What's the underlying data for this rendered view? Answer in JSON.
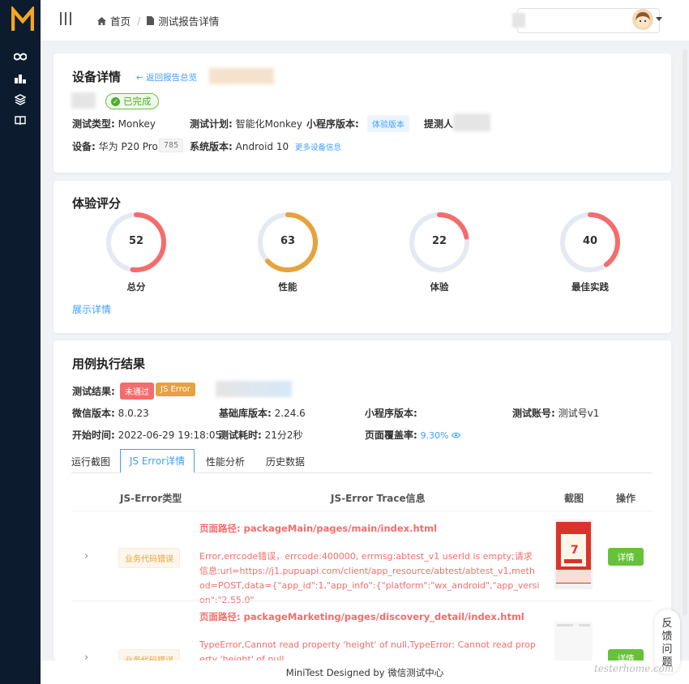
{
  "header": {
    "home": "首页",
    "current": "测试报告详情"
  },
  "device": {
    "title": "设备详情",
    "back_link": "← 返回报告总览",
    "status": "已完成",
    "test_type_label": "测试类型:",
    "test_type": "Monkey",
    "plan_label": "测试计划:",
    "plan": "智能化Monkey",
    "mp_version_label": "小程序版本:",
    "mp_version": "体验版本",
    "submitter_label": "提测人",
    "device_label": "设备:",
    "device": "华为 P20 Pro",
    "device_code": "785",
    "os_label": "系统版本:",
    "os": "Android 10",
    "more_link": "更多设备信息"
  },
  "score": {
    "title": "体验评分",
    "gauges": [
      {
        "label": "总分",
        "value": "52",
        "pct": 0.52,
        "color": "#f56c6c"
      },
      {
        "label": "性能",
        "value": "63",
        "pct": 0.63,
        "color": "#e6a23c"
      },
      {
        "label": "体验",
        "value": "22",
        "pct": 0.22,
        "color": "#f56c6c"
      },
      {
        "label": "最佳实践",
        "value": "40",
        "pct": 0.4,
        "color": "#f56c6c"
      }
    ],
    "show_detail": "展示详情"
  },
  "result": {
    "title": "用例执行结果",
    "result_label": "测试结果:",
    "tag_fail": "未通过",
    "tag_js": "JS Error",
    "wechat_label": "微信版本:",
    "wechat": "8.0.23",
    "lib_label": "基础库版本:",
    "lib": "2.24.6",
    "mp_label": "小程序版本:",
    "account_label": "测试账号:",
    "account": "测试号v1",
    "start_label": "开始时间:",
    "start": "2022-06-29 19:18:05",
    "duration_label": "测试耗时:",
    "duration": "21分2秒",
    "coverage_label": "页面覆盖率:",
    "coverage": "9.30%",
    "tabs": [
      "运行截图",
      "JS Error详情",
      "性能分析",
      "历史数据"
    ],
    "columns": [
      "JS-Error类型",
      "JS-Error Trace信息",
      "截图",
      "操作"
    ],
    "rows": [
      {
        "type": "业务代码错误",
        "path": "页面路径: packageMain/pages/main/index.html",
        "trace": "Error,errcode错误，errcode:400000, errmsg:abtest_v1 userId is empty;请求信息:url=https://j1.pupuapi.com/client/app_resource/abtest/abtest_v1,method=POST,data={\"app_id\":1,\"app_info\":{\"platform\":\"wx_android\",\"app_version\":\"2.55.0\"",
        "action": "详情"
      },
      {
        "type": "业务代码错误",
        "path": "页面路径: packageMarketing/pages/discovery_detail/index.html",
        "trace": "TypeError,Cannot read property 'height' of null,TypeError: Cannot read property 'height' of null",
        "action": "详情"
      }
    ]
  },
  "footer": "MiniTest Designed by 微信测试中心",
  "feedback": "反馈问题",
  "watermark": "testerhome.com"
}
